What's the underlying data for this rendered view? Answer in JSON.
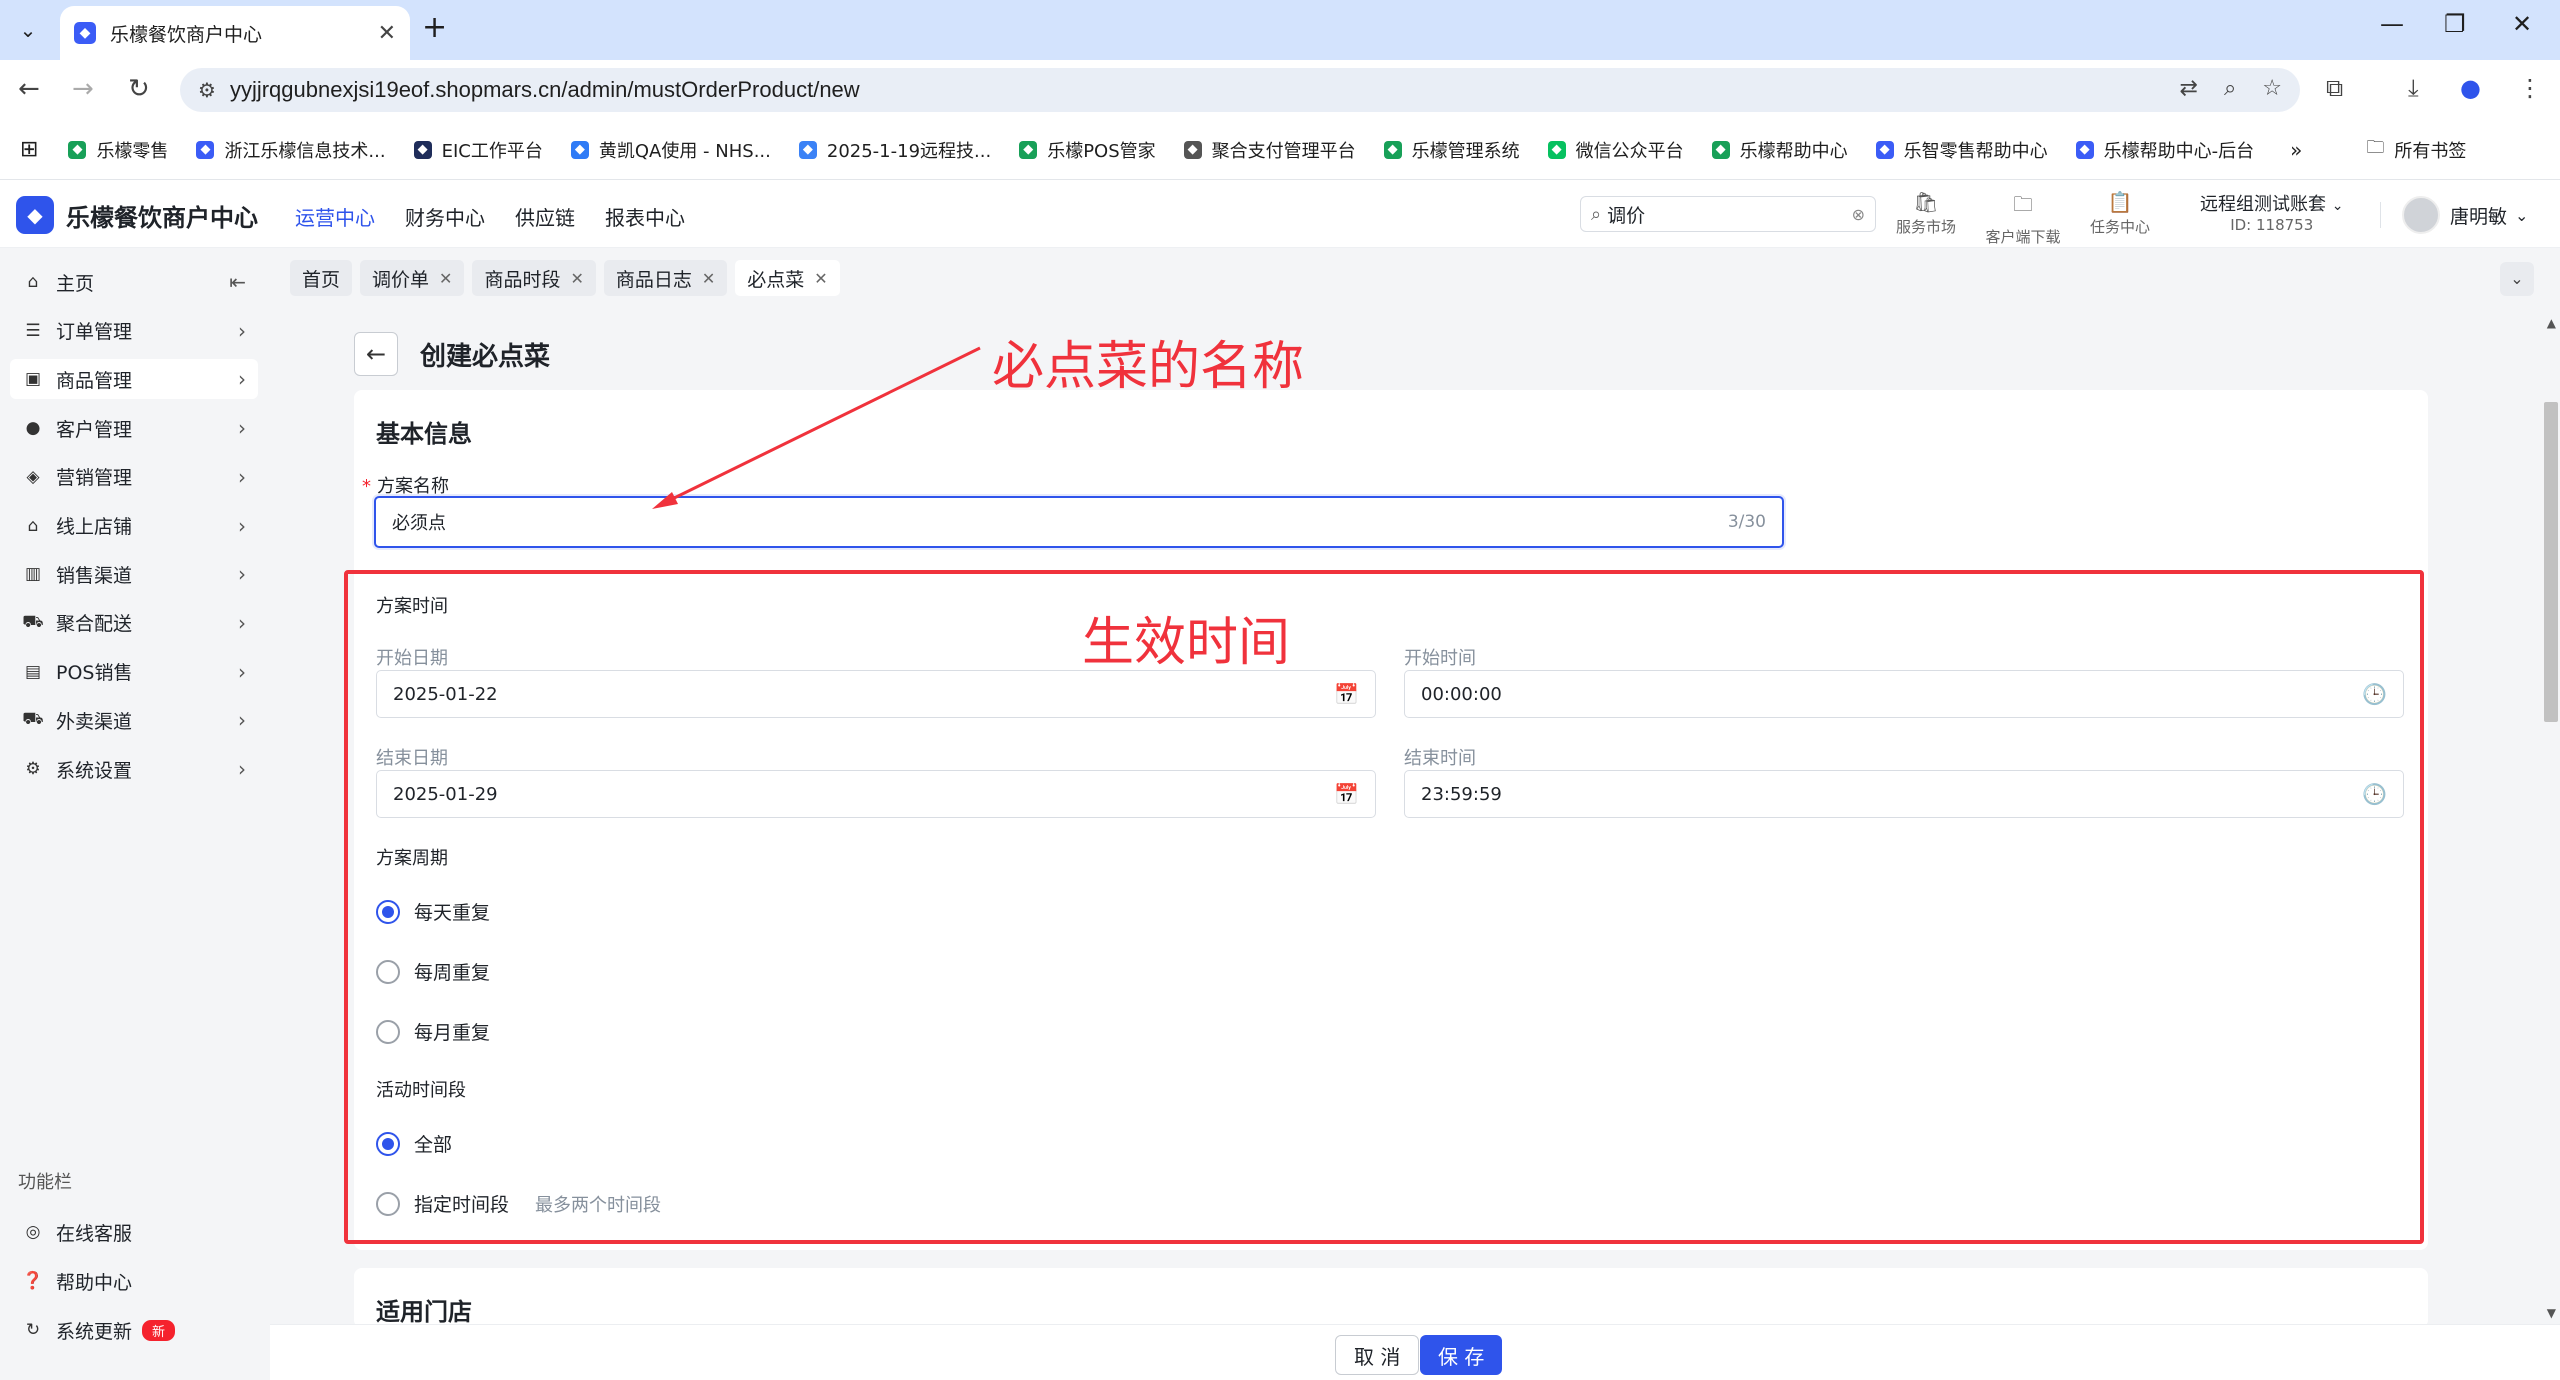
{
  "browser": {
    "tab_title": "乐檬餐饮商户中心",
    "url": "yyjjrqgubnexjsi19eof.shopmars.cn/admin/mustOrderProduct/new",
    "bookmarks": [
      {
        "label": "乐檬零售",
        "color": "#18a058"
      },
      {
        "label": "浙江乐檬信息技术...",
        "color": "#3b5cf6"
      },
      {
        "label": "EIC工作平台",
        "color": "#1f2d5a"
      },
      {
        "label": "黄凯QA使用 - NHS...",
        "color": "#2f7bf6"
      },
      {
        "label": "2025-1-19远程技...",
        "color": "#3b82f6"
      },
      {
        "label": "乐檬POS管家",
        "color": "#18a058"
      },
      {
        "label": "聚合支付管理平台",
        "color": "#555555"
      },
      {
        "label": "乐檬管理系统",
        "color": "#18a058"
      },
      {
        "label": "微信公众平台",
        "color": "#07c160"
      },
      {
        "label": "乐檬帮助中心",
        "color": "#18a058"
      },
      {
        "label": "乐智零售帮助中心",
        "color": "#3b5cf6"
      },
      {
        "label": "乐檬帮助中心-后台",
        "color": "#3b5cf6"
      }
    ],
    "all_bookmarks": "所有书签"
  },
  "header": {
    "logo": "乐檬餐饮商户中心",
    "nav": [
      "运营中心",
      "财务中心",
      "供应链",
      "报表中心"
    ],
    "search_value": "调价",
    "tools": [
      {
        "label": "服务市场",
        "icon": "bag-icon"
      },
      {
        "label": "客户端下载",
        "icon": "folder-icon"
      },
      {
        "label": "任务中心",
        "icon": "clipboard-icon"
      }
    ],
    "account_name": "远程组测试账套",
    "account_id": "ID: 118753",
    "user_name": "唐明敏"
  },
  "sidebar": {
    "items": [
      {
        "label": "主页",
        "icon": "home-icon"
      },
      {
        "label": "订单管理",
        "icon": "order-icon"
      },
      {
        "label": "商品管理",
        "icon": "product-icon"
      },
      {
        "label": "客户管理",
        "icon": "user-icon"
      },
      {
        "label": "营销管理",
        "icon": "tag-icon"
      },
      {
        "label": "线上店铺",
        "icon": "store-icon"
      },
      {
        "label": "销售渠道",
        "icon": "bank-icon"
      },
      {
        "label": "聚合配送",
        "icon": "truck-icon"
      },
      {
        "label": "POS销售",
        "icon": "pos-icon"
      },
      {
        "label": "外卖渠道",
        "icon": "delivery-icon"
      },
      {
        "label": "系统设置",
        "icon": "gear-icon"
      }
    ],
    "section_label": "功能栏",
    "bottom": [
      {
        "label": "在线客服",
        "icon": "headset-icon"
      },
      {
        "label": "帮助中心",
        "icon": "help-icon"
      },
      {
        "label": "系统更新",
        "icon": "refresh-icon",
        "badge": "新"
      }
    ]
  },
  "tags": [
    {
      "label": "首页",
      "closable": false
    },
    {
      "label": "调价单",
      "closable": true
    },
    {
      "label": "商品时段",
      "closable": true
    },
    {
      "label": "商品日志",
      "closable": true
    },
    {
      "label": "必点菜",
      "closable": true
    }
  ],
  "page": {
    "title": "创建必点菜",
    "basic_info_title": "基本信息",
    "name_label": "方案名称",
    "name_value": "必须点",
    "name_count": "3/30",
    "time_section": "方案时间",
    "start_date_label": "开始日期",
    "start_date": "2025-01-22",
    "start_time_label": "开始时间",
    "start_time": "00:00:00",
    "end_date_label": "结束日期",
    "end_date": "2025-01-29",
    "end_time_label": "结束时间",
    "end_time": "23:59:59",
    "cycle_label": "方案周期",
    "cycle_options": [
      "每天重复",
      "每周重复",
      "每月重复"
    ],
    "cycle_selected": 0,
    "period_label": "活动时间段",
    "period_options": [
      "全部",
      "指定时间段"
    ],
    "period_hint": "最多两个时间段",
    "stores_title": "适用门店"
  },
  "annotations": {
    "name_note": "必点菜的名称",
    "time_note": "生效时间",
    "color": "#f0323c"
  },
  "footer": {
    "cancel": "取 消",
    "save": "保 存"
  },
  "colors": {
    "primary": "#2f54eb",
    "danger": "#f5222d"
  }
}
